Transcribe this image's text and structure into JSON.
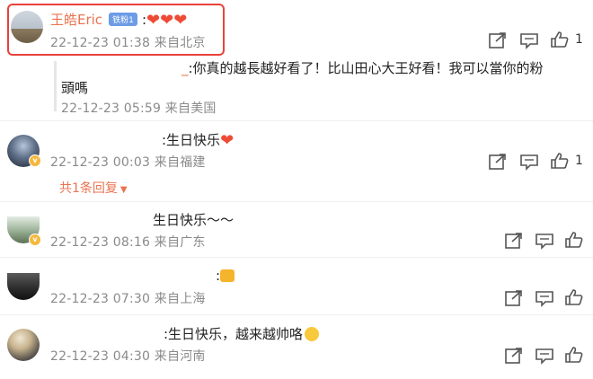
{
  "comments": [
    {
      "username": "王皓Eric",
      "badge": "铁粉1",
      "text": "❤️❤️❤️",
      "meta": "22-12-23 01:38 来自北京",
      "likes": "1",
      "highlighted": true
    },
    {
      "username": "_",
      "text_line1": ":你真的越長越好看了！比山田心大王好看！我可以當你的粉",
      "text_line2": "頭嗎",
      "meta": "22-12-23 05:59 来自美国"
    },
    {
      "text": ":生日快乐",
      "meta": "22-12-23 00:03 来自福建",
      "likes": "1",
      "replies": "共1条回复"
    },
    {
      "text": "生日快乐～～",
      "meta": "22-12-23 08:16 来自广东"
    },
    {
      "text": ":🍻",
      "meta": "22-12-23 07:30 来自上海"
    },
    {
      "text": ":生日快乐，越来越帅咯",
      "meta": "22-12-23 04:30 来自河南"
    }
  ],
  "icons": {
    "share": "share-icon",
    "comment": "comment-icon",
    "like": "thumb-up-icon"
  },
  "colors": {
    "username": "#eb7350",
    "highlight_border": "#e8423b",
    "meta": "#8a8a8a"
  }
}
